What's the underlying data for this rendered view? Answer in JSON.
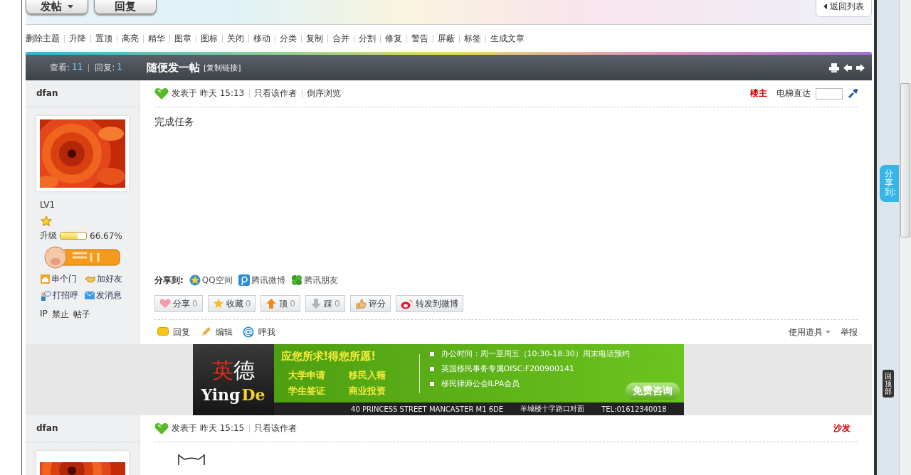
{
  "toolbar": {
    "buttons": [
      {
        "label": "发帖",
        "dropdown": true
      },
      {
        "label": "回复",
        "dropdown": false
      }
    ],
    "back_link": "返回列表"
  },
  "mod_actions": [
    "删除主题",
    "升降",
    "置顶",
    "高亮",
    "精华",
    "图章",
    "图标",
    "关闭",
    "移动",
    "分类",
    "复制",
    "合并",
    "分割",
    "修复",
    "警告",
    "屏蔽",
    "标签",
    "生成文章"
  ],
  "thread_header": {
    "views_label": "查看:",
    "views": "11",
    "replies_label": "回复:",
    "replies": "1",
    "title": "随便发一帖",
    "copy_link": "[复制链接]"
  },
  "posts": [
    {
      "author": "dfan",
      "level_name": "LV1",
      "upgrade_label": "升级",
      "level": 0.6667,
      "percent": "66.67%",
      "profile_links": [
        {
          "kind": "home",
          "label": "串个门"
        },
        {
          "kind": "friend",
          "label": "加好友"
        },
        {
          "kind": "greet",
          "label": "打招呼"
        },
        {
          "kind": "mail",
          "label": "发消息"
        }
      ],
      "admin_links": [
        "IP",
        "禁止",
        "帖子"
      ],
      "posted": "发表于 昨天 15:13",
      "links": [
        "只看该作者",
        "倒序浏览"
      ],
      "floor": "楼主",
      "jump_label": "电梯直达",
      "content": "完成任务",
      "share_label": "分享到:",
      "share_targets": [
        {
          "kind": "qzone",
          "label": "QQ空间"
        },
        {
          "kind": "tweibo",
          "label": "腾讯微博"
        },
        {
          "kind": "pengyou",
          "label": "腾讯朋友"
        }
      ],
      "reactions": [
        {
          "kind": "heart",
          "label": "分享",
          "count": "0"
        },
        {
          "kind": "star",
          "label": "收藏",
          "count": "0"
        },
        {
          "kind": "up",
          "label": "顶",
          "count": "0"
        },
        {
          "kind": "down",
          "label": "踩",
          "count": "0"
        },
        {
          "kind": "thumb",
          "label": "评分"
        },
        {
          "kind": "weibo",
          "label": "转发到微博"
        }
      ],
      "actions": [
        {
          "kind": "reply",
          "label": "回复"
        },
        {
          "kind": "edit",
          "label": "编辑"
        },
        {
          "kind": "at",
          "label": "呼我"
        }
      ],
      "tools": "使用道具",
      "report": "举报"
    },
    {
      "author": "dfan",
      "posted": "发表于 昨天 15:15",
      "links": [
        "只看该作者"
      ],
      "floor": "沙发"
    }
  ],
  "ad": {
    "brand_cn_1": "英",
    "brand_cn_2": "德",
    "brand_en_1": "Ying",
    "brand_en_2": "De",
    "slogan": "应您所求!得您所愿!",
    "services": [
      "大学申请",
      "移民入籍",
      "学生签证",
      "商业投资"
    ],
    "points": [
      "办公时间：周一至周五（10:30-18:30）周末电话预约",
      "英国移民事务专属OISC:F200900141",
      "移民律师公会ILPA会员"
    ],
    "cta": "免费咨询",
    "address": "40  PRINCESS  STREET  MANCASTER  M1  6DE",
    "landmark": "羊城楼十字路口对面",
    "phone": "TEL:01612340018"
  },
  "float": {
    "share_tab": "分享到:",
    "back_top": "回顶部"
  }
}
